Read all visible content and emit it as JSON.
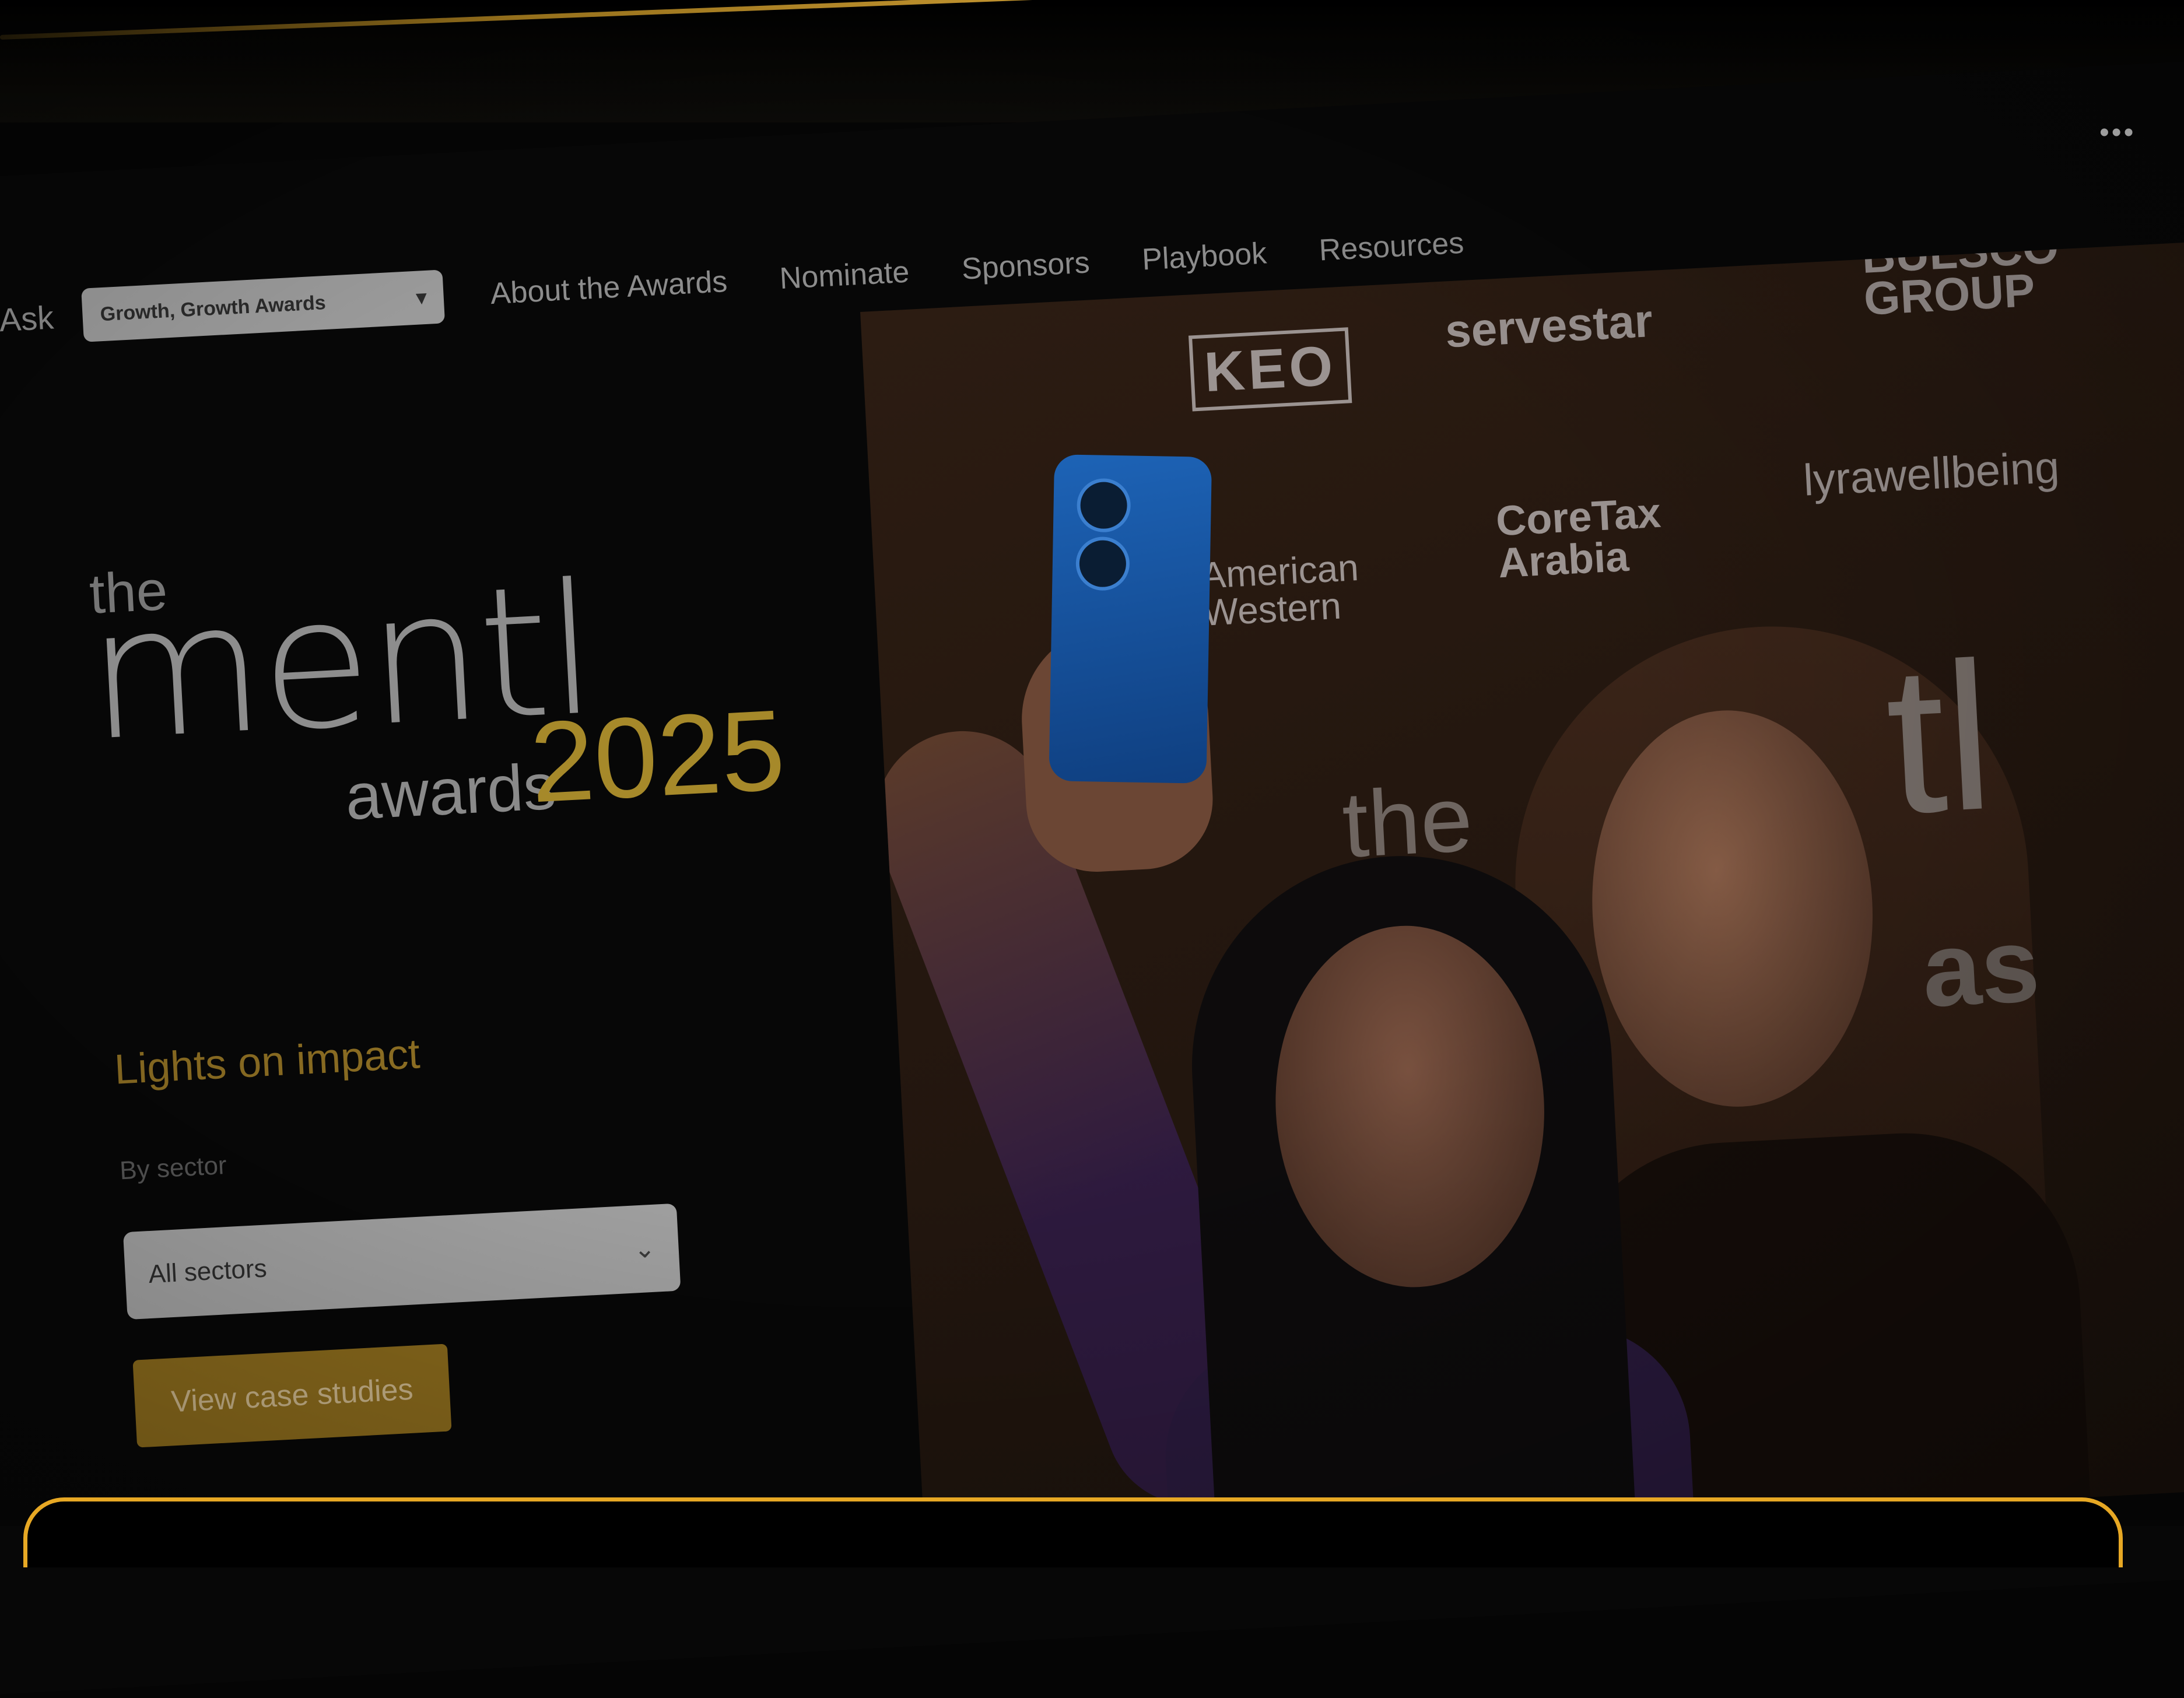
{
  "nav": {
    "ask_label": "Ask",
    "select_value": "Growth, Growth Awards",
    "items": [
      "About the Awards",
      "Nominate",
      "Sponsors",
      "Playbook",
      "Resources"
    ]
  },
  "logo": {
    "the": "the",
    "mentl": "mentl",
    "awards": "awards",
    "year": "2025"
  },
  "hero": {
    "tagline": "Lights on impact",
    "sector_label": "By sector",
    "sector_value": "All sectors",
    "cta_label": "View case studies"
  },
  "photo": {
    "sponsors": [
      "KEO",
      "servestar",
      "BULSCO GROUP",
      "lyrawellbeing",
      "CoreTax Arabia",
      "American Western"
    ],
    "backdrop_text": [
      "the",
      "tl",
      "as"
    ]
  },
  "colors": {
    "accent_gold": "#a6892a",
    "panel_border": "#e7a824",
    "cta_bg": "#8a6a1c"
  },
  "icons": {
    "menu": "more-dots-icon",
    "chevron": "chevron-down-icon"
  }
}
